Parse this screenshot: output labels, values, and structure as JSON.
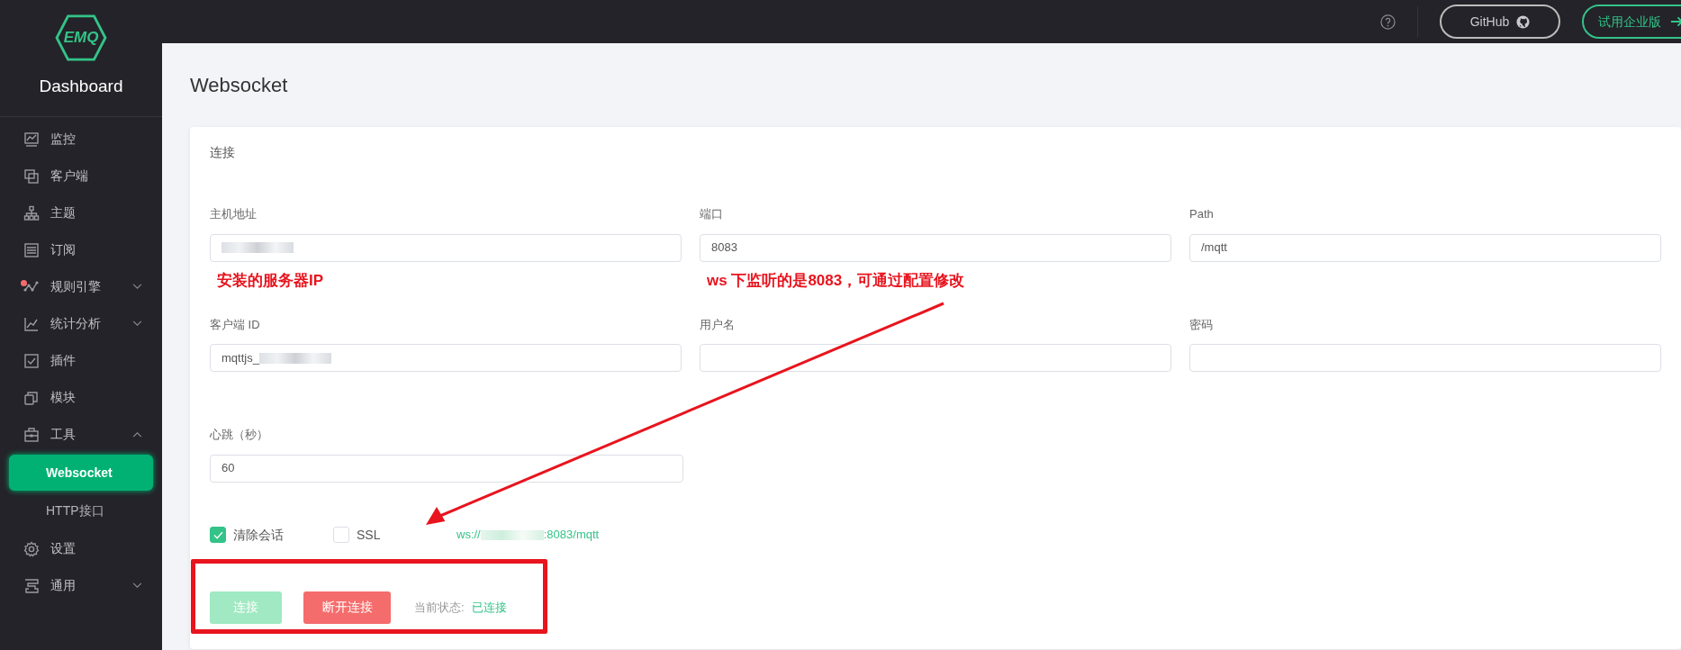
{
  "sidebar": {
    "logo": "EMQ",
    "title": "Dashboard",
    "items": [
      {
        "label": "监控",
        "selected": false
      },
      {
        "label": "客户端",
        "selected": false
      },
      {
        "label": "主题",
        "selected": false
      },
      {
        "label": "订阅",
        "selected": false
      },
      {
        "label": "规则引擎",
        "dot": true,
        "expanded": false,
        "selected": false
      },
      {
        "label": "统计分析",
        "expanded": false,
        "selected": false
      },
      {
        "label": "插件",
        "selected": false
      },
      {
        "label": "模块",
        "selected": false
      },
      {
        "label": "工具",
        "expanded": true,
        "selected": false,
        "children": [
          {
            "label": "Websocket",
            "selected": true
          },
          {
            "label": "HTTP接口",
            "selected": false
          }
        ]
      },
      {
        "label": "设置",
        "selected": false
      },
      {
        "label": "通用",
        "expanded": false,
        "selected": false
      }
    ]
  },
  "topbar": {
    "github": "GitHub",
    "trial": "试用企业版"
  },
  "page": {
    "title": "Websocket"
  },
  "card": {
    "title": "连接",
    "fields": [
      {
        "label": "主机地址",
        "redacted": true,
        "note": "安装的服务器IP"
      },
      {
        "label": "端口",
        "value": "8083",
        "note": "ws 下监听的是8083，可通过配置修改"
      },
      {
        "label": "Path",
        "value": "/mqtt"
      },
      {
        "label": "客户端 ID",
        "value": "mqttjs_",
        "redacted": true
      },
      {
        "label": "用户名"
      },
      {
        "label": "密码"
      },
      {
        "label": "心跳（秒）",
        "value": "60"
      }
    ],
    "checkboxes": [
      {
        "label": "清除会话",
        "checked": true
      },
      {
        "label": "SSL",
        "checked": false
      }
    ],
    "url": {
      "prefix": "ws://",
      "redacted": true,
      "suffix": ":8083/mqtt"
    },
    "arrow": true,
    "actions": {
      "highlighted": true,
      "connect": {
        "label": "连接",
        "disabled": true
      },
      "disconnect": {
        "label": "断开连接",
        "disabled": false
      },
      "status_label": "当前状态:",
      "status": "已连接"
    }
  }
}
